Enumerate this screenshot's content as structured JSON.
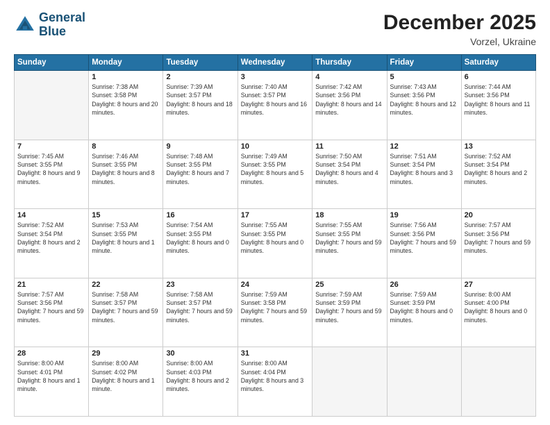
{
  "header": {
    "logo_line1": "General",
    "logo_line2": "Blue",
    "month_year": "December 2025",
    "location": "Vorzel, Ukraine"
  },
  "weekdays": [
    "Sunday",
    "Monday",
    "Tuesday",
    "Wednesday",
    "Thursday",
    "Friday",
    "Saturday"
  ],
  "weeks": [
    [
      {
        "num": "",
        "empty": true
      },
      {
        "num": "1",
        "sunrise": "7:38 AM",
        "sunset": "3:58 PM",
        "daylight": "8 hours and 20 minutes."
      },
      {
        "num": "2",
        "sunrise": "7:39 AM",
        "sunset": "3:57 PM",
        "daylight": "8 hours and 18 minutes."
      },
      {
        "num": "3",
        "sunrise": "7:40 AM",
        "sunset": "3:57 PM",
        "daylight": "8 hours and 16 minutes."
      },
      {
        "num": "4",
        "sunrise": "7:42 AM",
        "sunset": "3:56 PM",
        "daylight": "8 hours and 14 minutes."
      },
      {
        "num": "5",
        "sunrise": "7:43 AM",
        "sunset": "3:56 PM",
        "daylight": "8 hours and 12 minutes."
      },
      {
        "num": "6",
        "sunrise": "7:44 AM",
        "sunset": "3:56 PM",
        "daylight": "8 hours and 11 minutes."
      }
    ],
    [
      {
        "num": "7",
        "sunrise": "7:45 AM",
        "sunset": "3:55 PM",
        "daylight": "8 hours and 9 minutes."
      },
      {
        "num": "8",
        "sunrise": "7:46 AM",
        "sunset": "3:55 PM",
        "daylight": "8 hours and 8 minutes."
      },
      {
        "num": "9",
        "sunrise": "7:48 AM",
        "sunset": "3:55 PM",
        "daylight": "8 hours and 7 minutes."
      },
      {
        "num": "10",
        "sunrise": "7:49 AM",
        "sunset": "3:55 PM",
        "daylight": "8 hours and 5 minutes."
      },
      {
        "num": "11",
        "sunrise": "7:50 AM",
        "sunset": "3:54 PM",
        "daylight": "8 hours and 4 minutes."
      },
      {
        "num": "12",
        "sunrise": "7:51 AM",
        "sunset": "3:54 PM",
        "daylight": "8 hours and 3 minutes."
      },
      {
        "num": "13",
        "sunrise": "7:52 AM",
        "sunset": "3:54 PM",
        "daylight": "8 hours and 2 minutes."
      }
    ],
    [
      {
        "num": "14",
        "sunrise": "7:52 AM",
        "sunset": "3:54 PM",
        "daylight": "8 hours and 2 minutes."
      },
      {
        "num": "15",
        "sunrise": "7:53 AM",
        "sunset": "3:55 PM",
        "daylight": "8 hours and 1 minute."
      },
      {
        "num": "16",
        "sunrise": "7:54 AM",
        "sunset": "3:55 PM",
        "daylight": "8 hours and 0 minutes."
      },
      {
        "num": "17",
        "sunrise": "7:55 AM",
        "sunset": "3:55 PM",
        "daylight": "8 hours and 0 minutes."
      },
      {
        "num": "18",
        "sunrise": "7:55 AM",
        "sunset": "3:55 PM",
        "daylight": "7 hours and 59 minutes."
      },
      {
        "num": "19",
        "sunrise": "7:56 AM",
        "sunset": "3:56 PM",
        "daylight": "7 hours and 59 minutes."
      },
      {
        "num": "20",
        "sunrise": "7:57 AM",
        "sunset": "3:56 PM",
        "daylight": "7 hours and 59 minutes."
      }
    ],
    [
      {
        "num": "21",
        "sunrise": "7:57 AM",
        "sunset": "3:56 PM",
        "daylight": "7 hours and 59 minutes."
      },
      {
        "num": "22",
        "sunrise": "7:58 AM",
        "sunset": "3:57 PM",
        "daylight": "7 hours and 59 minutes."
      },
      {
        "num": "23",
        "sunrise": "7:58 AM",
        "sunset": "3:57 PM",
        "daylight": "7 hours and 59 minutes."
      },
      {
        "num": "24",
        "sunrise": "7:59 AM",
        "sunset": "3:58 PM",
        "daylight": "7 hours and 59 minutes."
      },
      {
        "num": "25",
        "sunrise": "7:59 AM",
        "sunset": "3:59 PM",
        "daylight": "7 hours and 59 minutes."
      },
      {
        "num": "26",
        "sunrise": "7:59 AM",
        "sunset": "3:59 PM",
        "daylight": "8 hours and 0 minutes."
      },
      {
        "num": "27",
        "sunrise": "8:00 AM",
        "sunset": "4:00 PM",
        "daylight": "8 hours and 0 minutes."
      }
    ],
    [
      {
        "num": "28",
        "sunrise": "8:00 AM",
        "sunset": "4:01 PM",
        "daylight": "8 hours and 1 minute."
      },
      {
        "num": "29",
        "sunrise": "8:00 AM",
        "sunset": "4:02 PM",
        "daylight": "8 hours and 1 minute."
      },
      {
        "num": "30",
        "sunrise": "8:00 AM",
        "sunset": "4:03 PM",
        "daylight": "8 hours and 2 minutes."
      },
      {
        "num": "31",
        "sunrise": "8:00 AM",
        "sunset": "4:04 PM",
        "daylight": "8 hours and 3 minutes."
      },
      {
        "num": "",
        "empty": true
      },
      {
        "num": "",
        "empty": true
      },
      {
        "num": "",
        "empty": true
      }
    ]
  ]
}
